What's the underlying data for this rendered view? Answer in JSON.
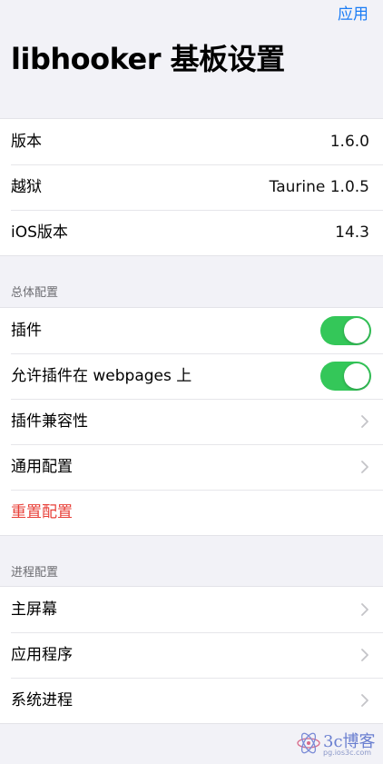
{
  "nav": {
    "apply_label": "应用"
  },
  "page": {
    "title": "libhooker 基板设置"
  },
  "info": {
    "rows": [
      {
        "label": "版本",
        "value": "1.6.0"
      },
      {
        "label": "越狱",
        "value": "Taurine 1.0.5"
      },
      {
        "label": "iOS版本",
        "value": "14.3"
      }
    ]
  },
  "general": {
    "header": "总体配置",
    "rows": [
      {
        "label": "插件",
        "toggle_on": true
      },
      {
        "label": "允许插件在 webpages 上",
        "toggle_on": true
      },
      {
        "label": "插件兼容性"
      },
      {
        "label": "通用配置"
      },
      {
        "label": "重置配置"
      }
    ]
  },
  "process": {
    "header": "进程配置",
    "rows": [
      {
        "label": "主屏幕"
      },
      {
        "label": "应用程序"
      },
      {
        "label": "系统进程"
      }
    ]
  },
  "watermark": {
    "text": "3c博客",
    "sub": "pg.ios3c.com"
  },
  "colors": {
    "accent": "#1a7cf5",
    "toggle_on": "#34c759",
    "danger": "#e8413a",
    "background": "#f2f2f7"
  },
  "icons": {
    "chevron": "chevron-right-icon",
    "watermark": "atom-logo-icon"
  }
}
